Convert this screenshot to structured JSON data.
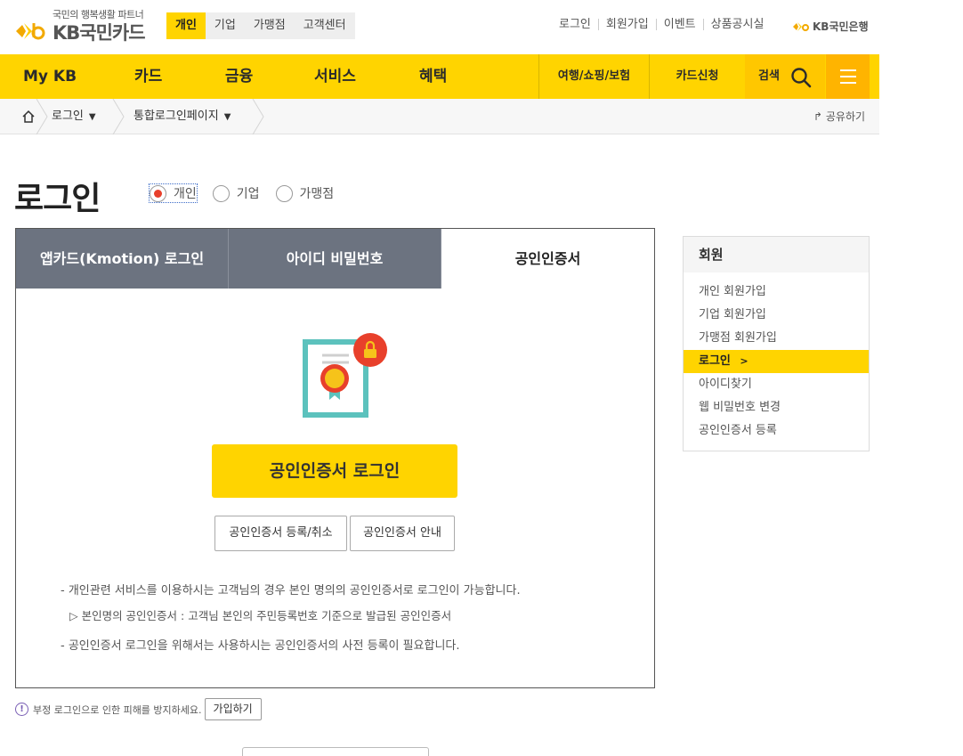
{
  "header": {
    "tagline": "국민의 행복생활 파트너",
    "brand": "KB국민카드",
    "segments": [
      {
        "label": "개인",
        "active": true
      },
      {
        "label": "기업",
        "active": false
      },
      {
        "label": "가맹점",
        "active": false
      },
      {
        "label": "고객센터",
        "active": false
      }
    ],
    "util_links": [
      "로그인",
      "회원가입",
      "이벤트",
      "상품공시실"
    ],
    "bank_logo": "KB국민은행"
  },
  "gnb": {
    "items": [
      "My KB",
      "카드",
      "금융",
      "서비스",
      "혜택"
    ],
    "sub_items": [
      "여행/쇼핑/보험",
      "카드신청"
    ],
    "search_label": "검색",
    "menu_icon": "hamburger-icon",
    "accent_color": "#ffd400"
  },
  "breadcrumb": {
    "home_icon": "home-icon",
    "items": [
      "로그인",
      "통합로그인페이지"
    ],
    "share_label": "공유하기"
  },
  "page": {
    "title": "로그인",
    "member_types": [
      {
        "label": "개인",
        "checked": true
      },
      {
        "label": "기업",
        "checked": false
      },
      {
        "label": "가맹점",
        "checked": false
      }
    ]
  },
  "login": {
    "tabs": [
      {
        "label": "앱카드(Kmotion) 로그인",
        "active": false
      },
      {
        "label": "아이디 비밀번호",
        "active": false
      },
      {
        "label": "공인인증서",
        "active": true
      }
    ],
    "illustration": "certificate-lock-icon",
    "primary_button": "공인인증서 로그인",
    "secondary_buttons": [
      "공인인증서 등록/취소",
      "공인인증서 안내"
    ],
    "notices": [
      "- 개인관련 서비스를 이용하시는 고객님의 경우 본인 명의의 공인인증서로 로그인이 가능합니다.",
      "▷  본인명의 공인인증서 : 고객님 본인의 주민등록번호 기준으로 발급된 공인인증서",
      "- 공인인증서 로그인을 위해서는 사용하시는 공인인증서의 사전 등록이 필요합니다."
    ]
  },
  "warning": {
    "icon": "exclamation-icon",
    "text": "부정 로그인으로 인한 피해를 방지하세요.",
    "button": "가입하기"
  },
  "side_menu": {
    "title": "회원",
    "items": [
      {
        "label": "개인 회원가입",
        "active": false
      },
      {
        "label": "기업 회원가입",
        "active": false
      },
      {
        "label": "가맹점 회원가입",
        "active": false
      },
      {
        "label": "로그인",
        "active": true
      },
      {
        "label": "아이디찾기",
        "active": false
      },
      {
        "label": "웹 비밀번호 변경",
        "active": false
      },
      {
        "label": "공인인증서 등록",
        "active": false
      }
    ]
  }
}
